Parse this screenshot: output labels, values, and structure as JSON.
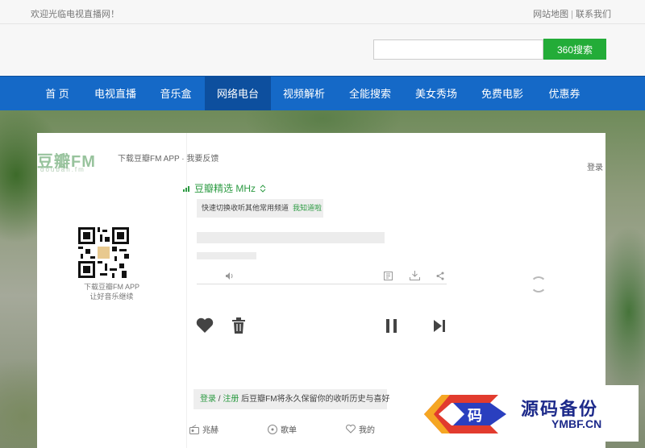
{
  "topbar": {
    "welcome": "欢迎光临电视直播网！",
    "sitemap": "网站地图",
    "separator": "|",
    "contact": "联系我们"
  },
  "search": {
    "placeholder": "",
    "button_label": "360搜索"
  },
  "nav": {
    "items": [
      {
        "label": "首 页"
      },
      {
        "label": "电视直播"
      },
      {
        "label": "音乐盒"
      },
      {
        "label": "网络电台"
      },
      {
        "label": "视频解析"
      },
      {
        "label": "全能搜索"
      },
      {
        "label": "美女秀场"
      },
      {
        "label": "免费电影"
      },
      {
        "label": "优惠券"
      }
    ],
    "active_index": 3,
    "color": "#1569c7"
  },
  "player": {
    "logo": "豆瓣FM",
    "logo_sub": "douban.fm",
    "top_links": "下载豆瓣FM APP · 我要反馈",
    "login": "登录",
    "qr_caption_1": "下载豆瓣FM APP",
    "qr_caption_2": "让好音乐继续",
    "channel": "豆瓣精选 MHz",
    "tip_text": "快速切换收听其他常用频道",
    "tip_action": "我知道啦",
    "save_tip": {
      "login": "登录",
      "slash": " / ",
      "register": "注册",
      "rest": " 后豆瓣FM将永久保留你的收听历史与喜好"
    },
    "bottom_nav": [
      {
        "label": "兆赫",
        "icon": "radio-icon"
      },
      {
        "label": "歌单",
        "icon": "songlist-icon"
      },
      {
        "label": "我的",
        "icon": "heart-outline-icon"
      }
    ],
    "accent": "#2d9b43"
  },
  "watermark": {
    "title": "源码备份",
    "sub": "YMBF.CN",
    "glyph": "码"
  }
}
